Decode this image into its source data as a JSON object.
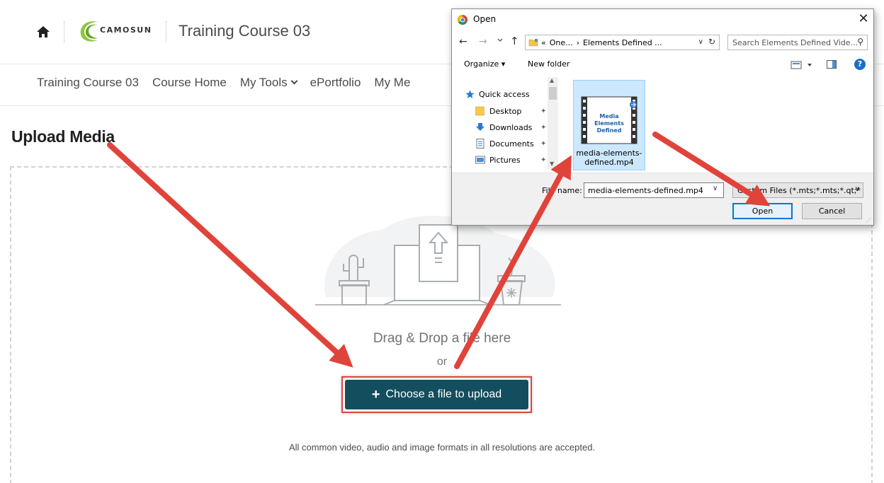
{
  "header": {
    "logo_text": "CAMOSUN",
    "course_title": "Training Course 03"
  },
  "navbar": {
    "items": [
      "Training Course 03",
      "Course Home",
      "My Tools",
      "ePortfolio",
      "My Me"
    ]
  },
  "page": {
    "heading": "Upload Media",
    "drag_text": "Drag & Drop a file here",
    "or_text": "or",
    "choose_button": "Choose a file to upload",
    "formats_text": "All common video, audio and image formats in all resolutions are accepted."
  },
  "dialog": {
    "title": "Open",
    "close": "✕",
    "address": {
      "prefix": "«",
      "crumbs": [
        "One...",
        "›",
        "Elements Defined ..."
      ]
    },
    "search_placeholder": "Search Elements Defined Vide...",
    "toolbar": {
      "organize": "Organize ▾",
      "new_folder": "New folder",
      "help": "?"
    },
    "nav_items": [
      {
        "label": "Quick access",
        "icon": "star-icon"
      },
      {
        "label": "Desktop",
        "icon": "folder-icon"
      },
      {
        "label": "Downloads",
        "icon": "download-icon"
      },
      {
        "label": "Documents",
        "icon": "document-icon"
      },
      {
        "label": "Pictures",
        "icon": "pictures-icon"
      }
    ],
    "file": {
      "thumb_text_line1": "Media Elements",
      "thumb_text_line2": "Defined",
      "name_line1": "media-elements-",
      "name_line2": "defined.mp4"
    },
    "file_name_label": "File name:",
    "file_name_value": "media-elements-defined.mp4",
    "file_type_filter": "Custom Files (*.mts;*.mts;*.qt;*",
    "open_button": "Open",
    "cancel_button": "Cancel"
  },
  "colors": {
    "button_teal": "#134e5e",
    "arrow_red": "#e0433a",
    "selection_blue": "#cce8ff",
    "focus_blue": "#0078d7"
  }
}
